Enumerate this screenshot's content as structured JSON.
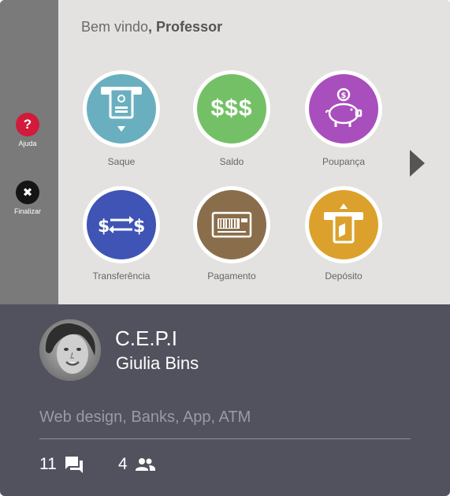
{
  "sidebar": {
    "help": {
      "glyph": "?",
      "label": "Ajuda"
    },
    "quit": {
      "glyph": "✖",
      "label": "Finalizar"
    }
  },
  "screen": {
    "welcome_prefix": "Bem vindo",
    "welcome_name": ", Professor",
    "tiles": [
      {
        "label": "Saque",
        "color": "#6aafbf",
        "icon": "atm-withdraw-icon"
      },
      {
        "label": "Saldo",
        "color": "#74c066",
        "icon": "dollars-icon",
        "glyph": "$$$"
      },
      {
        "label": "Poupança",
        "color": "#a94ebd",
        "icon": "piggy-bank-icon"
      },
      {
        "label": "Transferência",
        "color": "#3f54b4",
        "icon": "transfer-icon"
      },
      {
        "label": "Pagamento",
        "color": "#8a6e4b",
        "icon": "barcode-icon"
      },
      {
        "label": "Depósito",
        "color": "#dca12c",
        "icon": "deposit-icon"
      }
    ]
  },
  "profile": {
    "name": "C.E.P.I",
    "author": "Giulia Bins",
    "tags": "Web design, Banks, App, ATM",
    "comments": "11",
    "followers": "4"
  }
}
